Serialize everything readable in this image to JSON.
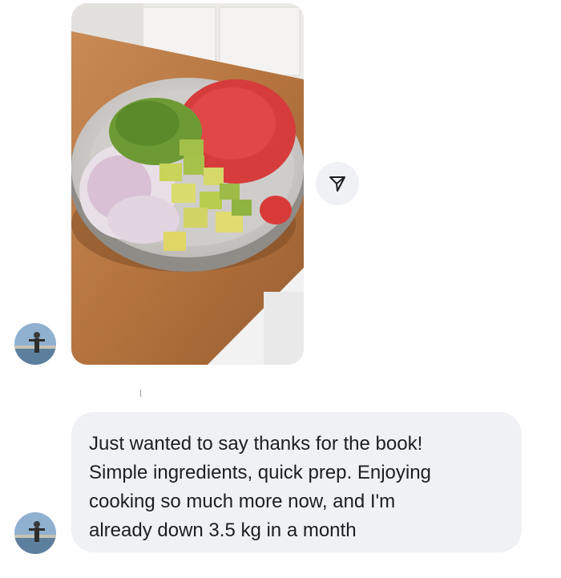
{
  "messages": [
    {
      "type": "photo",
      "image_alt": "",
      "share_icon": "share-icon"
    },
    {
      "type": "text",
      "lines": [
        "Just wanted to say thanks for the book!",
        "Simple ingredients, quick prep. Enjoying",
        "cooking so much more now, and I'm",
        "already down 3.5 kg in a month"
      ]
    }
  ],
  "colors": {
    "bubble_bg": "#eff1f4",
    "text": "#1c1e21",
    "page_bg": "#ffffff"
  }
}
